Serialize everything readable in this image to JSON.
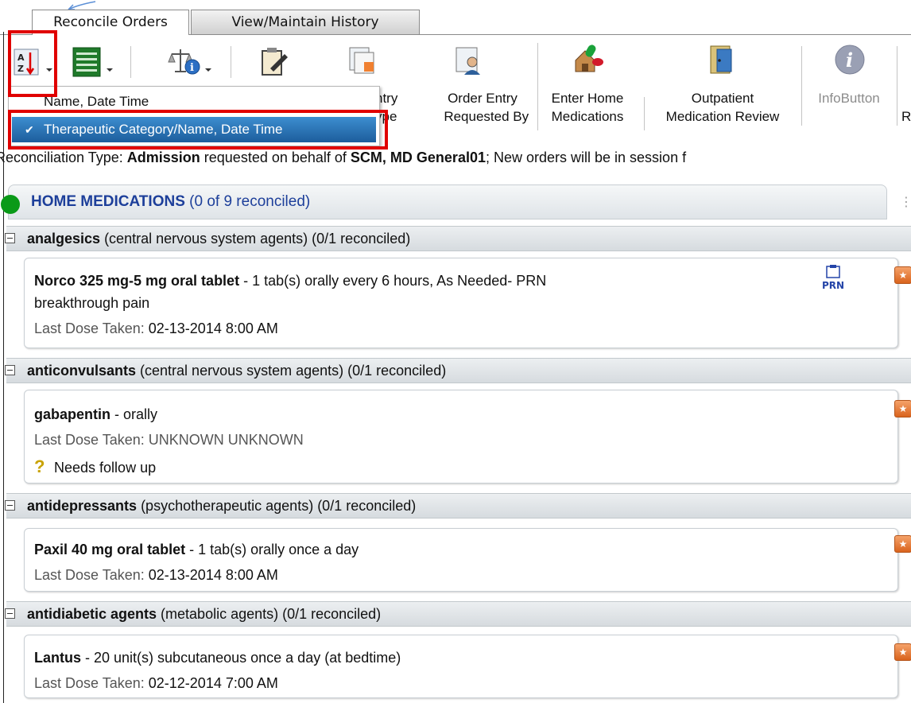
{
  "tabs": [
    {
      "label": "Reconcile Orders"
    },
    {
      "label": "View/Maintain History"
    }
  ],
  "toolbar": {
    "order_entry_type_label": "ntry\nype",
    "order_entry_requested_label": "Order Entry\nRequested By",
    "enter_home_meds_label": "Enter Home\nMedications",
    "outpatient_review_label": "Outpatient\nMedication Review",
    "infobutton_label": "InfoButton",
    "cut_label": "R"
  },
  "sort_menu": {
    "items": [
      {
        "label": "Name, Date Time"
      },
      {
        "label": "Therapeutic Category/Name, Date Time",
        "selected": true
      }
    ]
  },
  "info_line": {
    "prefix": "Reconciliation Type: ",
    "type": "Admission",
    "middle": " requested on behalf of ",
    "provider": "SCM, MD General01",
    "suffix": "; New orders will be in session f"
  },
  "section": {
    "title": "HOME MEDICATIONS",
    "count": " (0 of 9 reconciled)",
    "status_color": "#0a9a18"
  },
  "categories": [
    {
      "name": "analgesics",
      "detail": " (central nervous system agents) (0/1 reconciled)"
    },
    {
      "name": "anticonvulsants",
      "detail": " (central nervous system agents) (0/1 reconciled)"
    },
    {
      "name": "antidepressants",
      "detail": " (psychotherapeutic agents) (0/1 reconciled)"
    },
    {
      "name": "antidiabetic agents",
      "detail": " (metabolic agents) (0/1 reconciled)"
    }
  ],
  "medications": [
    {
      "name": "Norco 325 mg-5 mg oral tablet",
      "sig": " - 1 tab(s) orally every 6 hours, As Needed- PRN",
      "sig2": "breakthrough pain",
      "dose_label": "Last Dose Taken: ",
      "dose_value": "02-13-2014 8:00 AM",
      "prn_label": "PRN"
    },
    {
      "name": "gabapentin",
      "sig": " -  orally",
      "dose_label": "Last Dose Taken: ",
      "dose_value": "UNKNOWN UNKNOWN",
      "followup": "Needs follow up"
    },
    {
      "name": "Paxil 40 mg oral tablet",
      "sig": " - 1 tab(s) orally once a day",
      "dose_label": "Last Dose Taken: ",
      "dose_value": "02-13-2014 8:00 AM"
    },
    {
      "name": "Lantus",
      "sig": " - 20 unit(s) subcutaneous once a day (at bedtime)",
      "dose_label": "Last Dose Taken: ",
      "dose_value": "02-12-2014 7:00 AM"
    }
  ],
  "colors": {
    "highlight_box": "#e00000",
    "menu_selected": "#1c5d9c",
    "section_title": "#1d3f9a"
  }
}
